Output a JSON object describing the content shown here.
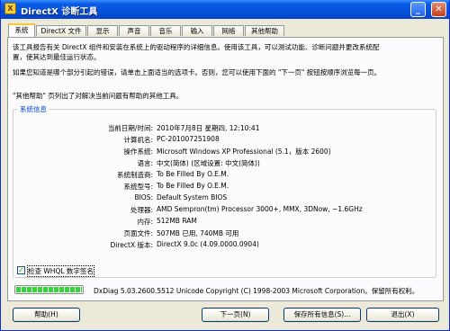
{
  "window": {
    "title": "DirectX 诊断工具",
    "app_icon": "X",
    "buttons": {
      "minimize": "_",
      "maximize": "□",
      "close": "✕"
    }
  },
  "tabs": [
    "系统",
    "DirectX 文件",
    "显示",
    "声音",
    "音乐",
    "输入",
    "网络",
    "其他帮助"
  ],
  "intro": {
    "line1": "该工具报告有关 DirectX 组件和安装在系统上的驱动程序的详细信息。使用该工具，可以测试功能、诊断问题并更改系统配",
    "line2": "置，使其达到最佳运行状态。",
    "line3": "如果您知道是哪个部分引起的错误，请单击上面适当的选项卡。否则，您可以使用下面的 \"下一页\" 按钮按顺序浏览每一页。",
    "line4": "\"其他帮助\" 页列出了对解决当前问题有帮助的其他工具。"
  },
  "system_info": {
    "legend": "系统信息",
    "rows": [
      {
        "key": "当前日期/时间:",
        "value": "2010年7月8日 星期四, 12:10:41"
      },
      {
        "key": "计算机名:",
        "value": "PC-201007251908"
      },
      {
        "key": "操作系统:",
        "value": "Microsoft Windows XP Professional (5.1，版本 2600)"
      },
      {
        "key": "语言:",
        "value": "中文(简体) (区域设置: 中文(简体))"
      },
      {
        "key": "系统制造商:",
        "value": "To Be Filled By O.E.M."
      },
      {
        "key": "系统型号:",
        "value": "To Be Filled By O.E.M."
      },
      {
        "key": "BIOS:",
        "value": "Default System BIOS"
      },
      {
        "key": "处理器:",
        "value": "AMD Sempron(tm) Processor 3000+,  MMX,  3DNow, ~1.6GHz"
      },
      {
        "key": "内存:",
        "value": "512MB RAM"
      },
      {
        "key": "页面文件:",
        "value": "507MB 已用, 740MB 可用"
      },
      {
        "key": "DirectX 版本:",
        "value": "DirectX 9.0c (4.09.0000.0904)"
      }
    ]
  },
  "whql_check": {
    "label": "检查 WHQL 数字签名",
    "checked": true,
    "mark": "✓"
  },
  "progress": {
    "complete_fraction": 1.0
  },
  "version_text": "DxDiag 5.03.2600.5512 Unicode  Copyright (C) 1998-2003 Microsoft Corporation。保留所有权利。",
  "buttons": {
    "help": "帮助(H)",
    "next": "下一页(N)",
    "save_all": "保存所有信息(S)...",
    "exit": "退出(X)"
  }
}
